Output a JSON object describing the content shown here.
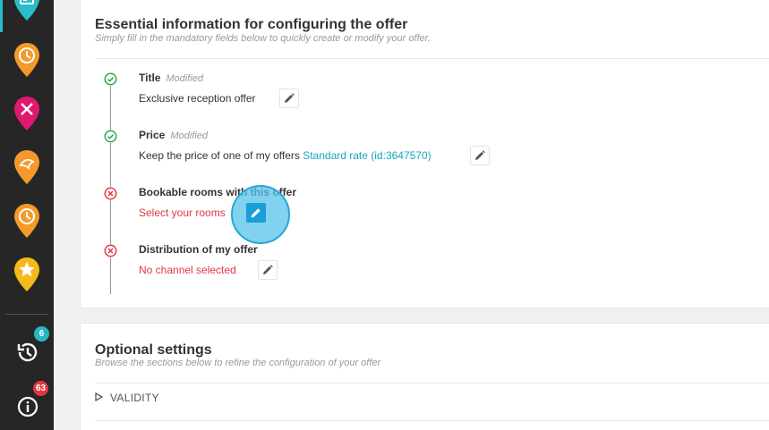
{
  "sidebar": {
    "history_badge": "6",
    "info_badge": "63",
    "colors": {
      "teal": "#2bbcc9",
      "orange": "#f39a2b",
      "magenta": "#e0196f",
      "yellow": "#f6b91a"
    },
    "items": [
      {
        "icon": "bed-pin-icon"
      },
      {
        "icon": "clock-pin-icon"
      },
      {
        "icon": "restaurant-pin-icon"
      },
      {
        "icon": "spa-pin-icon"
      },
      {
        "icon": "clock-pin-icon"
      },
      {
        "icon": "star-pin-icon"
      },
      {
        "icon": "history-icon"
      },
      {
        "icon": "info-icon"
      }
    ]
  },
  "essential": {
    "title": "Essential information for configuring the offer",
    "subtitle": "Simply fill in the mandatory fields below to quickly create or modify your offer.",
    "steps": [
      {
        "title": "Title",
        "tag": "Modified",
        "value": "Exclusive reception offer",
        "status": "done"
      },
      {
        "title": "Price",
        "tag": "Modified",
        "value_prefix": "Keep the price of one of my offers ",
        "value_link": "Standard rate (id:3647570)",
        "status": "done"
      },
      {
        "title": "Bookable rooms with this offer",
        "value": "Select your rooms",
        "status": "error"
      },
      {
        "title": "Distribution of my offer",
        "value": "No channel selected",
        "status": "error"
      }
    ]
  },
  "optional": {
    "title": "Optional settings",
    "subtitle": "Browse the sections below to refine the configuration of your offer",
    "sections": [
      {
        "label": "VALIDITY"
      }
    ]
  }
}
